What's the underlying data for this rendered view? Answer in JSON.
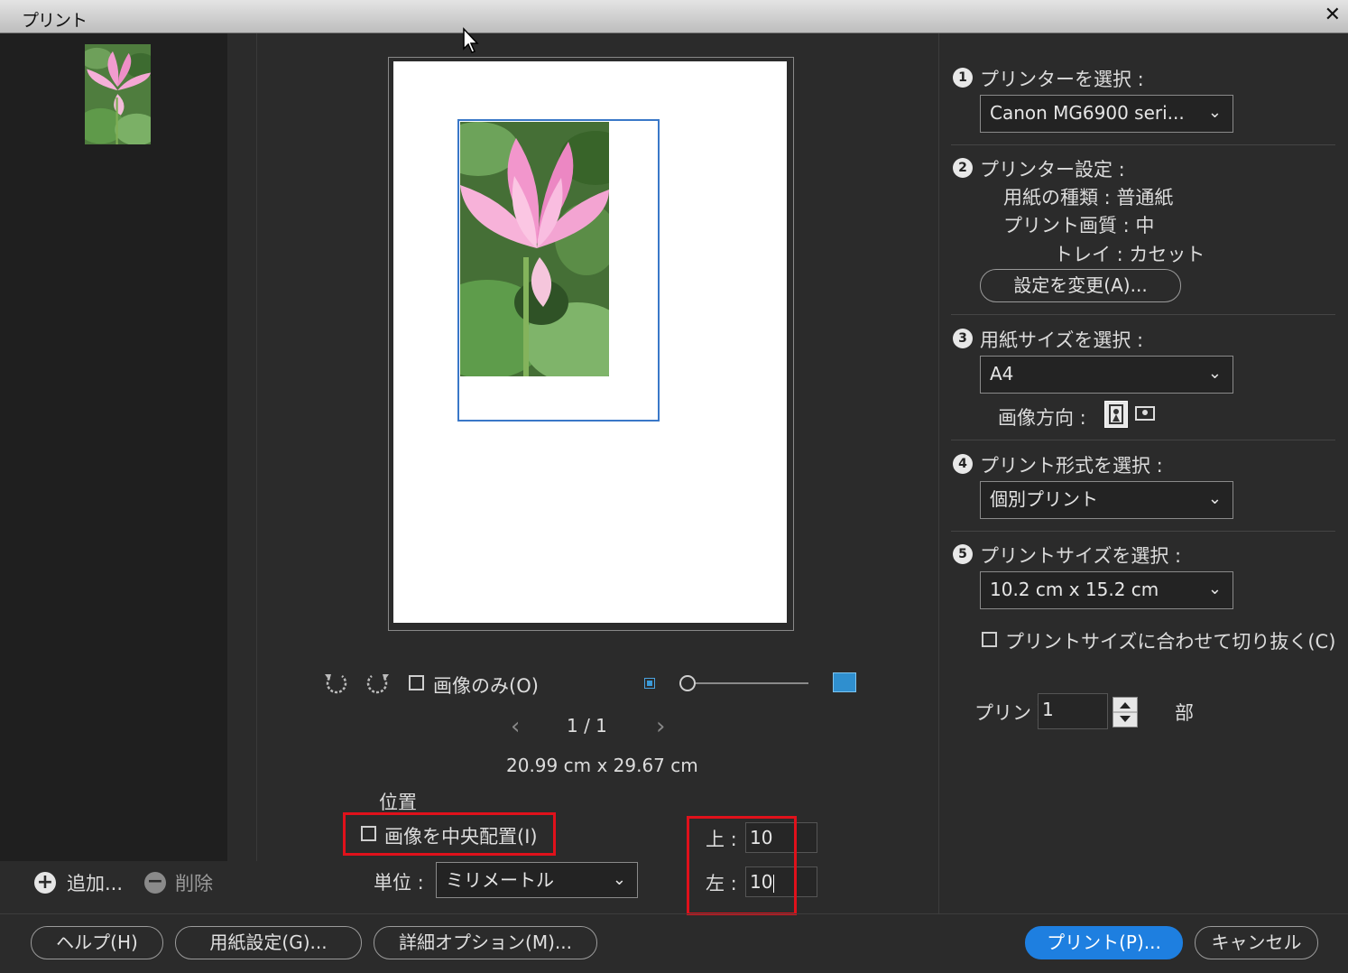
{
  "window": {
    "title": "プリント",
    "close_glyph": "✕"
  },
  "left_panel": {
    "add_label": "追加...",
    "remove_label": "削除"
  },
  "preview": {
    "only_image_label": "画像のみ(O)",
    "page_indicator": "1 / 1",
    "paper_size": "20.99 cm x 29.67 cm",
    "prev_glyph": "‹",
    "next_glyph": "›"
  },
  "position": {
    "section_label": "位置",
    "center_label": "画像を中央配置(I)",
    "unit_label": "単位 :",
    "unit_value": "ミリメートル",
    "top_label": "上 :",
    "top_value": "10",
    "left_label": "左 :",
    "left_value": "10"
  },
  "right": {
    "step1": {
      "num": "1",
      "label": "プリンターを選択 :",
      "value": "Canon MG6900 seri..."
    },
    "step2": {
      "num": "2",
      "label": "プリンター設定 :",
      "paper_type": "用紙の種類 : 普通紙",
      "quality": "プリント画質 : 中",
      "tray": "トレイ : カセット",
      "change_button": "設定を変更(A)..."
    },
    "step3": {
      "num": "3",
      "label": "用紙サイズを選択 :",
      "value": "A4",
      "orientation_label": "画像方向 :"
    },
    "step4": {
      "num": "4",
      "label": "プリント形式を選択 :",
      "value": "個別プリント"
    },
    "step5": {
      "num": "5",
      "label": "プリントサイズを選択 :",
      "value": "10.2 cm x 15.2 cm",
      "crop_label": "プリントサイズに合わせて切り抜く(C)"
    },
    "copies": {
      "label": "プリント",
      "value": "1",
      "unit": "部"
    }
  },
  "footer": {
    "help": "ヘルプ(H)",
    "page_setup": "用紙設定(G)...",
    "more_options": "詳細オプション(M)...",
    "print": "プリント(P)...",
    "cancel": "キャンセル"
  },
  "colors": {
    "accent": "#1e7fe0",
    "highlight": "#e0111b",
    "selection": "#3a78c8"
  }
}
